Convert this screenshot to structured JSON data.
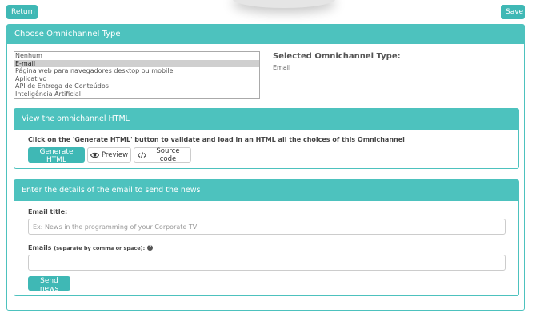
{
  "topbar": {
    "return_label": "Return",
    "save_label": "Save"
  },
  "omnichannel": {
    "header": "Choose Omnichannel Type",
    "options": [
      "Nenhum",
      "E-mail",
      "Página web para navegadores desktop ou mobile",
      "Aplicativo",
      "API de Entrega de Conteúdos",
      "Inteligência Artificial"
    ],
    "selected_index": 1,
    "selected_label": "Selected Omnichannel Type:",
    "selected_value": "Email"
  },
  "view_html": {
    "header": "View the omnichannel HTML",
    "instruction": "Click on the 'Generate HTML' button to validate and load in an HTML all the choices of this Omnichannel",
    "generate_label": "Generate HTML",
    "preview_label": "Preview",
    "source_label": "Source code"
  },
  "email_details": {
    "header": "Enter the details of the email to send the news",
    "title_label": "Email title:",
    "title_placeholder": "Ex: News in the programming of your Corporate TV",
    "title_value": "",
    "emails_label": "Emails",
    "emails_hint": "(separate by comma or space):",
    "emails_value": "",
    "send_label": "Send news"
  },
  "colors": {
    "accent": "#4dc2be",
    "button": "#3fb8b5"
  },
  "icons": {
    "preview": "eye-icon",
    "source": "code-icon",
    "help": "question-circle-icon"
  }
}
